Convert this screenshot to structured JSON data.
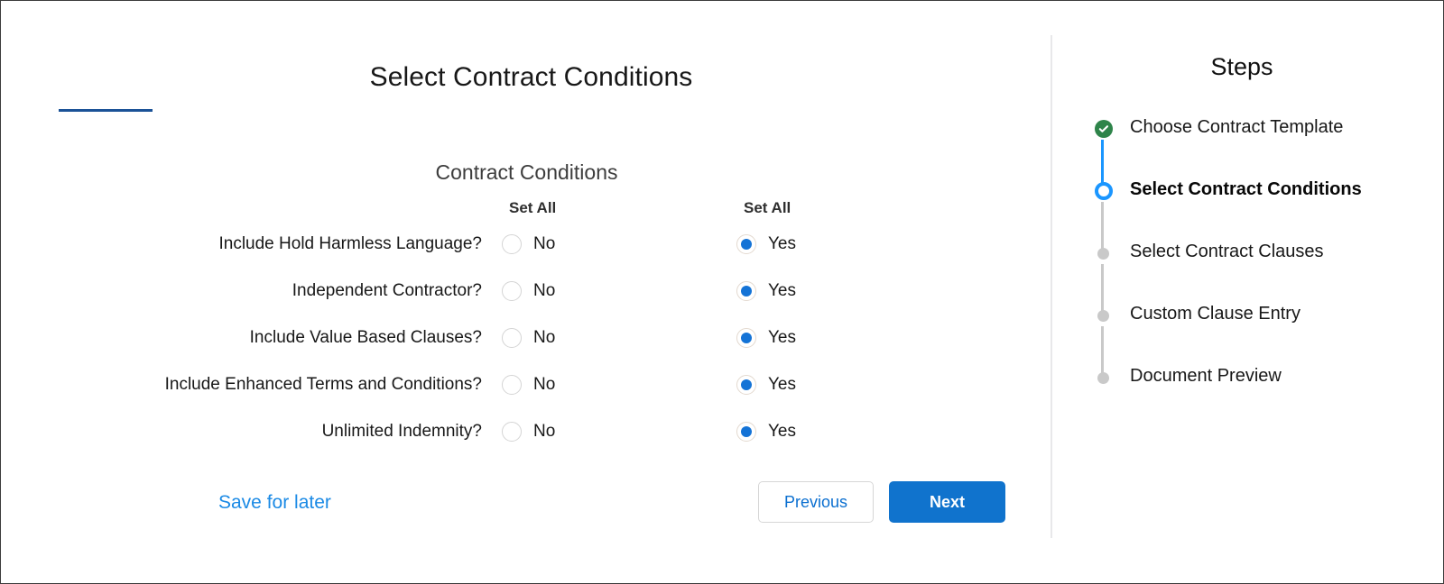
{
  "page": {
    "title": "Select Contract Conditions",
    "section_title": "Contract Conditions"
  },
  "colors": {
    "accent_blue": "#1073cd",
    "link_blue": "#1b8ae5",
    "progress_underline": "#1b5297",
    "step_done_green": "#2e844a",
    "step_current_blue": "#1b96ff",
    "step_todo_grey": "#c9c9c9",
    "radio_selected_blue": "#1473d6"
  },
  "set_all": {
    "no_label": "Set All",
    "yes_label": "Set All"
  },
  "conditions": [
    {
      "question": "Include Hold Harmless Language?",
      "no_label": "No",
      "yes_label": "Yes",
      "selected": "Yes"
    },
    {
      "question": "Independent Contractor?",
      "no_label": "No",
      "yes_label": "Yes",
      "selected": "Yes"
    },
    {
      "question": "Include Value Based Clauses?",
      "no_label": "No",
      "yes_label": "Yes",
      "selected": "Yes"
    },
    {
      "question": "Include Enhanced Terms and Conditions?",
      "no_label": "No",
      "yes_label": "Yes",
      "selected": "Yes"
    },
    {
      "question": "Unlimited Indemnity?",
      "no_label": "No",
      "yes_label": "Yes",
      "selected": "Yes"
    }
  ],
  "actions": {
    "save_for_later": "Save for later",
    "previous": "Previous",
    "next": "Next"
  },
  "steps": {
    "heading": "Steps",
    "items": [
      {
        "label": "Choose Contract Template",
        "state": "done"
      },
      {
        "label": "Select Contract Conditions",
        "state": "current"
      },
      {
        "label": "Select Contract Clauses",
        "state": "todo"
      },
      {
        "label": "Custom Clause Entry",
        "state": "todo"
      },
      {
        "label": "Document Preview",
        "state": "todo"
      }
    ]
  }
}
